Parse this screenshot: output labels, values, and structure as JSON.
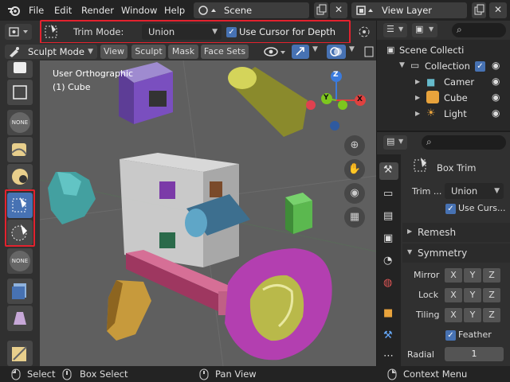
{
  "menu": {
    "items": [
      "File",
      "Edit",
      "Render",
      "Window",
      "Help"
    ],
    "scene": "Scene",
    "view_layer": "View Layer"
  },
  "tool_header": {
    "trim_mode_label": "Trim Mode:",
    "trim_mode_value": "Union",
    "use_cursor_label": "Use Cursor for Depth"
  },
  "mode_header": {
    "mode": "Sculpt Mode",
    "view": "View",
    "sculpt": "Sculpt",
    "mask": "Mask",
    "face_sets": "Face Sets"
  },
  "viewport": {
    "view_name": "User Orthographic",
    "object": "(1) Cube",
    "gizmo": {
      "z": "Z",
      "y": "Y",
      "x": "X"
    }
  },
  "toolbar": {
    "none1": "NONE",
    "none2": "NONE"
  },
  "outliner": {
    "items": [
      "Scene Collecti",
      "Collection",
      "Camer",
      "Cube",
      "Light"
    ]
  },
  "properties": {
    "tool_name": "Box Trim",
    "trim_label": "Trim ...",
    "trim_value": "Union",
    "use_cursor": "Use Curs...",
    "remesh": "Remesh",
    "symmetry": "Symmetry",
    "mirror": "Mirror",
    "lock": "Lock",
    "tiling": "Tiling",
    "axes": [
      "X",
      "Y",
      "Z"
    ],
    "feather": "Feather",
    "radial": "Radial",
    "radial_value": "1"
  },
  "statusbar": {
    "select": "Select",
    "box_select": "Box Select",
    "pan_view": "Pan View",
    "context_menu": "Context Menu"
  },
  "colors": {
    "accent": "#4772b3",
    "highlight": "#e3222e",
    "viewport_bg": "#5f5f5f"
  }
}
